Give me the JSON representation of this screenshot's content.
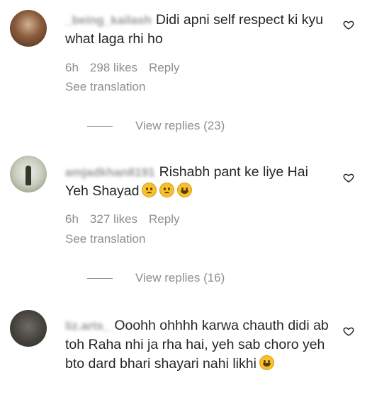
{
  "comments": [
    {
      "username": "_being_kailash",
      "text": "Didi apni self respect ki kyu what laga rhi ho",
      "time": "6h",
      "likes": "298 likes",
      "reply": "Reply",
      "see_translation": "See translation",
      "view_replies": "View replies (23)"
    },
    {
      "username": "amjadkhan8191",
      "text": "Rishabh pant ke liye Hai Yeh Shayad",
      "emojis": [
        "sad-face-emoji",
        "sad-face-emoji",
        "tears-of-joy-emoji"
      ],
      "time": "6h",
      "likes": "327 likes",
      "reply": "Reply",
      "see_translation": "See translation",
      "view_replies": "View replies (16)"
    },
    {
      "username": "liz.arts_",
      "text": "Ooohh ohhhh karwa chauth didi ab toh Raha nhi ja rha hai, yeh sab choro yeh bto dard bhari shayari nahi likhi",
      "emojis": [
        "tears-of-joy-emoji"
      ]
    }
  ],
  "icons": {
    "like": "heart-outline-icon"
  },
  "colors": {
    "text": "#262626",
    "meta": "#8e8e8e",
    "background": "#ffffff"
  }
}
